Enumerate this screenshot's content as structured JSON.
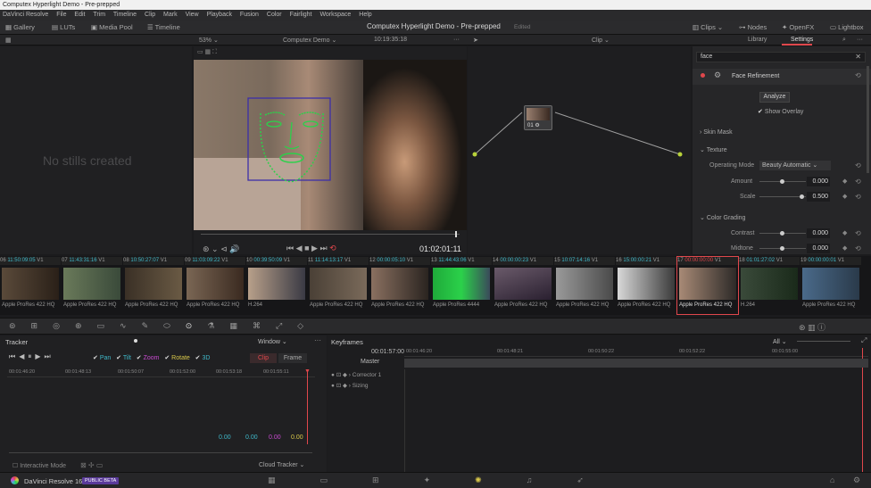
{
  "window": {
    "title": "Computex Hyperlight Demo - Pre-prepped"
  },
  "menu": [
    "DaVinci Resolve",
    "File",
    "Edit",
    "Trim",
    "Timeline",
    "Clip",
    "Mark",
    "View",
    "Playback",
    "Fusion",
    "Color",
    "Fairlight",
    "Workspace",
    "Help"
  ],
  "toolbar": {
    "gallery": "Gallery",
    "luts": "LUTs",
    "media_pool": "Media Pool",
    "timeline": "Timeline",
    "project_title": "Computex Hyperlight Demo - Pre-prepped",
    "edited": "Edited",
    "clips": "Clips",
    "nodes": "Nodes",
    "openfx": "OpenFX",
    "lightbox": "Lightbox"
  },
  "subbar": {
    "zoom": "53%",
    "timeline_name": "Computex Demo",
    "timecode": "10:19:35:18",
    "clip_mode": "Clip",
    "library": "Library",
    "settings": "Settings"
  },
  "stills": {
    "empty": "No stills created"
  },
  "viewer": {
    "timecode": "01:02:01:11"
  },
  "node": {
    "label": "01"
  },
  "inspector": {
    "search": "face",
    "fx_name": "Face Refinement",
    "analyze": "Analyze",
    "show_overlay": "Show Overlay",
    "skin_mask": "Skin Mask",
    "texture": "Texture",
    "operating_mode_label": "Operating Mode",
    "operating_mode": "Beauty Automatic",
    "amount_label": "Amount",
    "amount": "0.000",
    "scale_label": "Scale",
    "scale": "0.500",
    "color_grading": "Color Grading",
    "contrast_label": "Contrast",
    "contrast": "0.000",
    "midtone_label": "Midtone",
    "midtone": "0.000"
  },
  "clips": [
    {
      "num": "06",
      "tc": "11:50:09:05",
      "track": "V1",
      "codec": "Apple ProRes 422 HQ"
    },
    {
      "num": "07",
      "tc": "11:43:31:16",
      "track": "V1",
      "codec": "Apple ProRes 422 HQ"
    },
    {
      "num": "08",
      "tc": "10:50:27:07",
      "track": "V1",
      "codec": "Apple ProRes 422 HQ"
    },
    {
      "num": "09",
      "tc": "11:03:09:22",
      "track": "V1",
      "codec": "Apple ProRes 422 HQ"
    },
    {
      "num": "10",
      "tc": "00:39:50:09",
      "track": "V1",
      "codec": "H.264"
    },
    {
      "num": "11",
      "tc": "11:14:13:17",
      "track": "V1",
      "codec": "Apple ProRes 422 HQ"
    },
    {
      "num": "12",
      "tc": "00:00:05:10",
      "track": "V1",
      "codec": "Apple ProRes 422 HQ"
    },
    {
      "num": "13",
      "tc": "11:44:43:06",
      "track": "V1",
      "codec": "Apple ProRes 4444"
    },
    {
      "num": "14",
      "tc": "00:00:00:23",
      "track": "V1",
      "codec": "Apple ProRes 422 HQ"
    },
    {
      "num": "15",
      "tc": "10:07:14:16",
      "track": "V1",
      "codec": "Apple ProRes 422 HQ"
    },
    {
      "num": "16",
      "tc": "15:00:00:21",
      "track": "V1",
      "codec": "Apple ProRes 422 HQ"
    },
    {
      "num": "17",
      "tc": "00:00:00:00",
      "track": "V1",
      "codec": "Apple ProRes 422 HQ"
    },
    {
      "num": "18",
      "tc": "01:01:27:02",
      "track": "V1",
      "codec": "H.264"
    },
    {
      "num": "19",
      "tc": "00:00:00:01",
      "track": "V1",
      "codec": "Apple ProRes 422 HQ"
    }
  ],
  "tracker": {
    "title": "Tracker",
    "window": "Window",
    "pan": "Pan",
    "tilt": "Tilt",
    "zoom": "Zoom",
    "rotate": "Rotate",
    "three_d": "3D",
    "clip_btn": "Clip",
    "frame_btn": "Frame",
    "ruler": [
      "00:01:46:20",
      "00:01:48:13",
      "00:01:50:07",
      "00:01:52:00",
      "00:01:53:18",
      "00:01:55:11"
    ],
    "values": [
      "0.00",
      "0.00",
      "0.00",
      "0.00"
    ],
    "interactive_mode": "Interactive Mode",
    "cloud_tracker": "Cloud Tracker"
  },
  "keyframes": {
    "title": "Keyframes",
    "filter": "All",
    "timecode": "00:01:57:00",
    "ruler": [
      "00:01:46:20",
      "00:01:48:21",
      "00:01:50:22",
      "00:01:52:22",
      "00:01:55:00"
    ],
    "master": "Master",
    "corrector": "Corrector 1",
    "sizing": "Sizing"
  },
  "footer": {
    "app": "DaVinci Resolve 16",
    "badge": "PUBLIC BETA"
  },
  "colors": {
    "accent_red": "#e0474c",
    "node_green": "#b8d23a",
    "face_mesh": "#2bd14a",
    "face_box": "#3c2fa8",
    "value_cyan": "#3fb8c9",
    "value_magenta": "#c94ad1",
    "value_yellow": "#d9c84a"
  }
}
